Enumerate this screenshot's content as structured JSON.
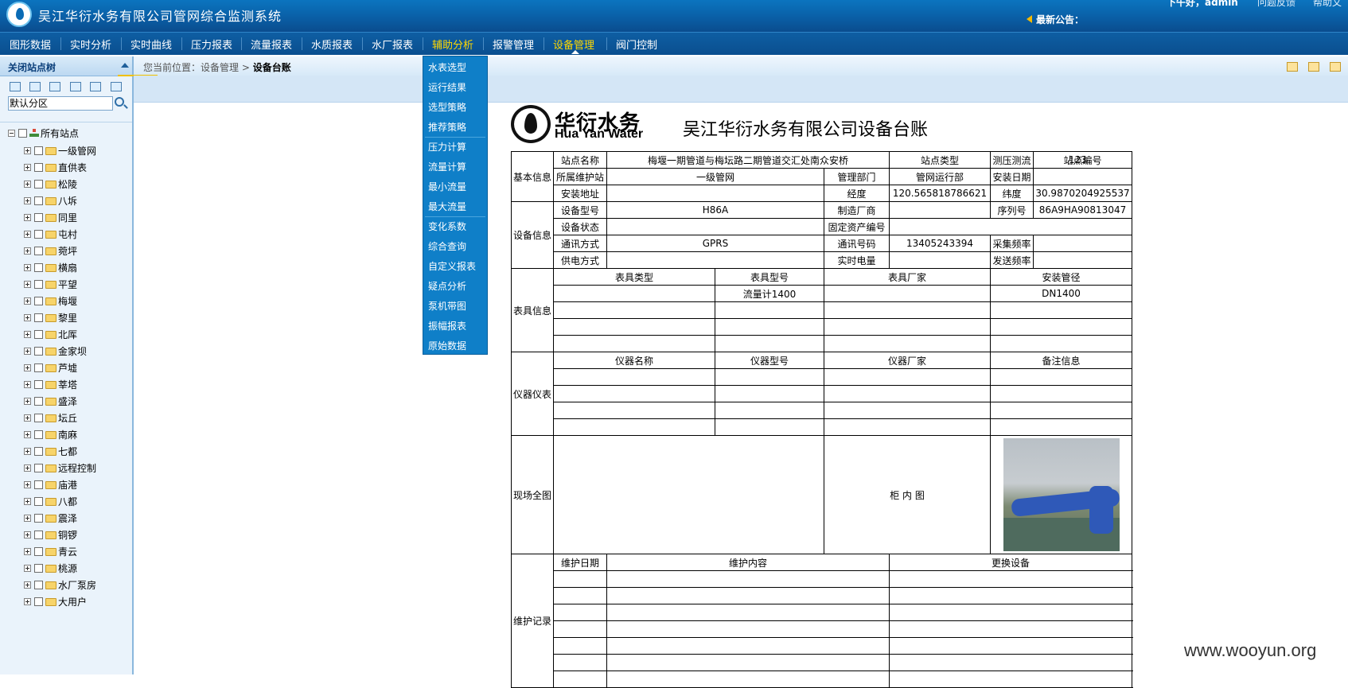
{
  "header": {
    "title": "吴江华衍水务有限公司管网综合监测系统",
    "greeting": "下午好，admin",
    "links": [
      "问题反馈",
      "帮助文"
    ],
    "notice_label": "最新公告："
  },
  "nav": {
    "items": [
      "图形数据",
      "实时分析",
      "实时曲线",
      "压力报表",
      "流量报表",
      "水质报表",
      "水厂报表",
      "辅助分析",
      "报警管理",
      "设备管理",
      "阀门控制"
    ],
    "dropdown": [
      "水表选型",
      "运行结果",
      "选型策略",
      "推荐策略",
      "压力计算",
      "流量计算",
      "最小流量",
      "最大流量",
      "变化系数",
      "综合查询",
      "自定义报表",
      "疑点分析",
      "泵机带图",
      "振幅报表",
      "原始数据"
    ]
  },
  "sidebar": {
    "title": "关闭站点树",
    "search_value": "默认分区",
    "root": "所有站点",
    "nodes": [
      "一级管网",
      "直供表",
      "松陵",
      "八坼",
      "同里",
      "屯村",
      "菀坪",
      "横扇",
      "平望",
      "梅堰",
      "黎里",
      "北厍",
      "金家坝",
      "芦墟",
      "莘塔",
      "盛泽",
      "坛丘",
      "南麻",
      "七都",
      "远程控制",
      "庙港",
      "八都",
      "震泽",
      "铜锣",
      "青云",
      "桃源",
      "水厂泵房",
      "大用户"
    ]
  },
  "breadcrumb": {
    "prefix": "您当前位置：",
    "parent": "设备管理",
    "sep": ">",
    "current": "设备台账"
  },
  "document": {
    "brand_cn": "华衍水务",
    "brand_en": "Hua Yan Water",
    "title": "吴江华衍水务有限公司设备台账",
    "categories": {
      "basic": "基本信息",
      "device": "设备信息",
      "meter": "表具信息",
      "instrument": "仪器仪表",
      "site": "现场全图",
      "maint": "维护记录"
    },
    "labels": {
      "station_name": "站点名称",
      "station_type": "站点类型",
      "station_no": "站点编号",
      "maint_station": "所属维护站",
      "mgmt_dept": "管理部门",
      "install_date": "安装日期",
      "install_addr": "安装地址",
      "longitude": "经度",
      "latitude": "纬度",
      "device_model": "设备型号",
      "manufacturer": "制造厂商",
      "serial_no": "序列号",
      "device_status": "设备状态",
      "asset_no": "固定资产编号",
      "comm_mode": "通讯方式",
      "comm_no": "通讯号码",
      "sample_freq": "采集频率",
      "power_mode": "供电方式",
      "realtime_power": "实时电量",
      "send_freq": "发送频率"
    },
    "values": {
      "station_name": "梅堰一期管道与梅坛路二期管道交汇处南众安桥",
      "station_type": "测压测流",
      "station_no": "123",
      "maint_station": "一级管网",
      "mgmt_dept": "管网运行部",
      "longitude": "120.565818786621",
      "latitude": "30.9870204925537",
      "device_model": "H86A",
      "serial_no": "86A9HA90813047",
      "comm_mode": "GPRS",
      "comm_no": "13405243394"
    },
    "meter_headers": [
      "表具类型",
      "表具型号",
      "表具厂家",
      "安装管径"
    ],
    "meter_row": {
      "model": "流量计1400",
      "diameter": "DN1400"
    },
    "instrument_headers": [
      "仪器名称",
      "仪器型号",
      "仪器厂家",
      "备注信息"
    ],
    "cabinet_label": "柜 内 图",
    "maint_headers": [
      "维护日期",
      "维护内容",
      "更换设备"
    ]
  },
  "watermark": "www.wooyun.org"
}
